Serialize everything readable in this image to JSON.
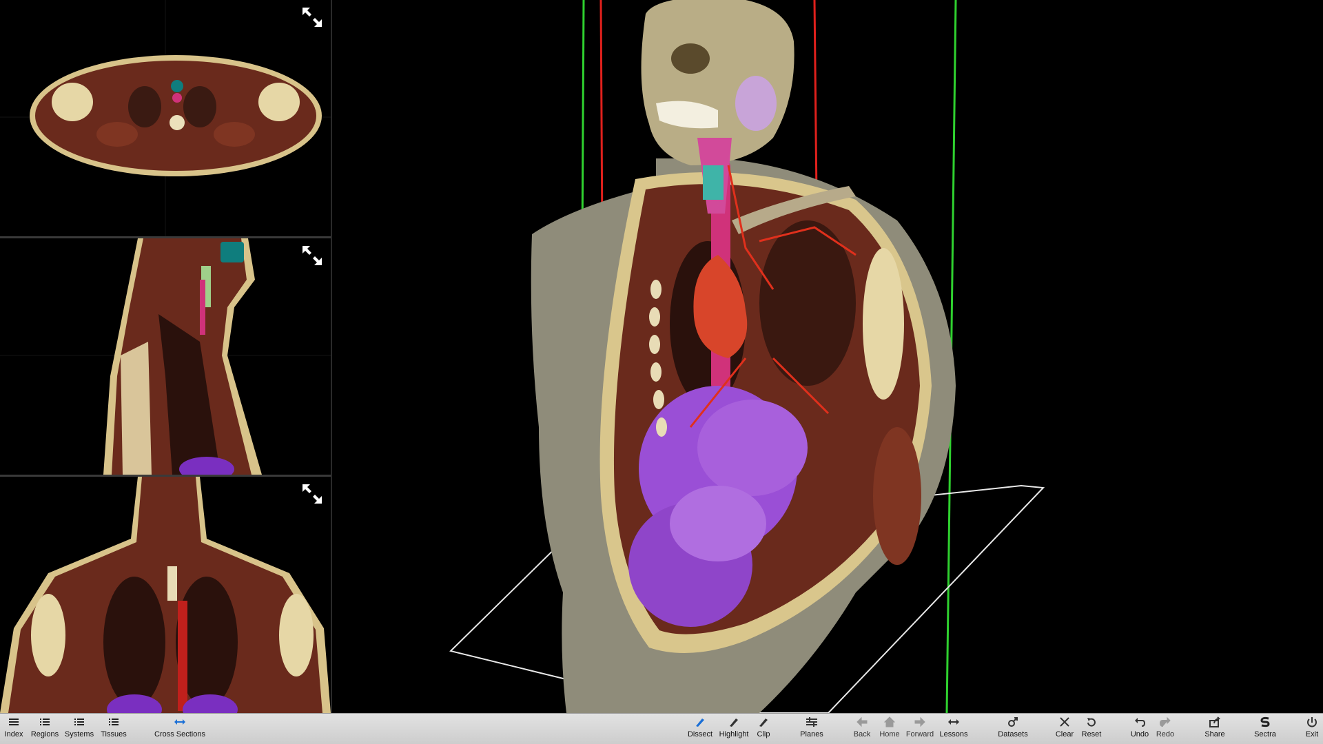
{
  "app": {
    "accent": "#1a6fd6",
    "toolbar_bg": "#d6d6d6"
  },
  "panels": [
    {
      "name": "axial",
      "expand_icon": "expand-arrows-icon"
    },
    {
      "name": "sagittal",
      "expand_icon": "expand-arrows-icon"
    },
    {
      "name": "coronal",
      "expand_icon": "expand-arrows-icon"
    }
  ],
  "toolbar": {
    "index": "Index",
    "regions": "Regions",
    "systems": "Systems",
    "tissues": "Tissues",
    "cross_sections": "Cross Sections",
    "dissect": "Dissect",
    "highlight": "Highlight",
    "clip": "Clip",
    "planes": "Planes",
    "back": "Back",
    "home": "Home",
    "forward": "Forward",
    "lessons": "Lessons",
    "datasets": "Datasets",
    "clear": "Clear",
    "reset": "Reset",
    "undo": "Undo",
    "redo": "Redo",
    "share": "Share",
    "sectra": "Sectra",
    "exit": "Exit"
  },
  "colors": {
    "clip_plane_red": "#e0201c",
    "clip_plane_green": "#2fd12f",
    "organ_purple": "#9a4fd6",
    "aorta_red": "#d8452a",
    "muscle": "#6a2a1c",
    "fat": "#d9c68c",
    "skin": "#8f8c7a"
  }
}
